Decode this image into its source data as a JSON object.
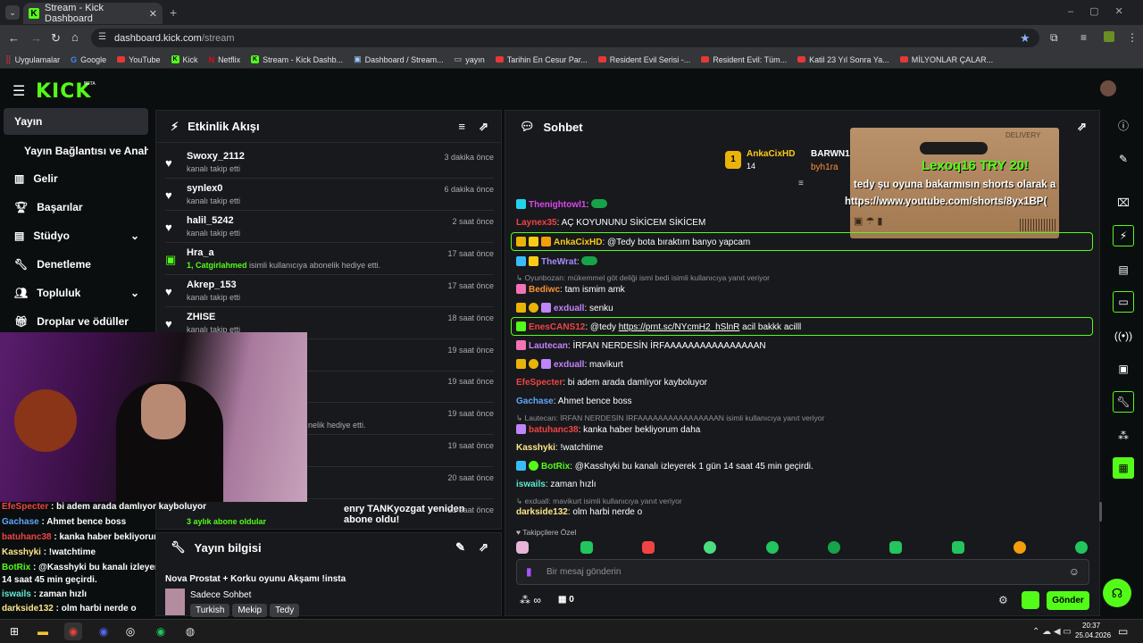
{
  "browser": {
    "tab_title": "Stream - Kick Dashboard",
    "url_host": "dashboard.kick.com",
    "url_path": "/stream",
    "bookmarks": [
      "Uygulamalar",
      "Google",
      "YouTube",
      "Kick",
      "Netflix",
      "Stream - Kick Dashb...",
      "Dashboard / Stream...",
      "yayın",
      "Tarihin En Cesur Par...",
      "Resident Evil Serisi -...",
      "Resident Evil: Tüm...",
      "Katil 23 Yıl Sonra Ya...",
      "MİLYONLAR ÇALAR..."
    ]
  },
  "logo": {
    "text": "KICK",
    "beta": "BETA"
  },
  "sidebar": {
    "items": [
      "Yayın",
      "Yayın Bağlantısı ve Anahtarı",
      "Gelir",
      "Başarılar",
      "Stüdyo",
      "Denetleme",
      "Topluluk",
      "Droplar ve ödüller"
    ]
  },
  "activity": {
    "title": "Etkinlik Akışı",
    "events": [
      {
        "name": "Swoxy_2112",
        "desc": "kanalı takip etti",
        "time": "3 dakika önce"
      },
      {
        "name": "synlex0",
        "desc": "kanalı takip etti",
        "time": "6 dakika önce"
      },
      {
        "name": "halil_5242",
        "desc": "kanalı takip etti",
        "time": "2 saat önce"
      },
      {
        "name": "Hra_a",
        "desc_user": "1, Catgirlahmed",
        "desc": "isimli kullanıcıya abonelik hediye etti.",
        "time": "17 saat önce"
      },
      {
        "name": "Akrep_153",
        "desc": "kanalı takip etti",
        "time": "17 saat önce"
      },
      {
        "name": "ZHISE",
        "desc": "kanalı takip etti",
        "time": "18 saat önce"
      },
      {
        "name": "",
        "desc": "",
        "time": "19 saat önce"
      },
      {
        "name": "",
        "desc": "",
        "time": "19 saat önce"
      },
      {
        "name": "",
        "desc": "nelik hediye etti.",
        "time": "19 saat önce"
      },
      {
        "name": "",
        "desc": "",
        "time": "19 saat önce"
      },
      {
        "name": "",
        "desc": "",
        "time": "20 saat önce"
      },
      {
        "name": "enry TANKyozgat yeniden abone oldu!",
        "desc": "3 aylık abone oldular",
        "time": "21 saat önce"
      }
    ]
  },
  "stream_info": {
    "title": "Yayın bilgisi",
    "stream_title": "Nova Prostat + Korku oyunu Akşamı !insta",
    "category": "Sadece Sohbet",
    "tags": [
      "Turkish",
      "Mekip",
      "Tedy"
    ]
  },
  "chat": {
    "title": "Sohbet",
    "pinned": {
      "user1": "AnkaCixHD",
      "user1_count": "14",
      "user2": "BARWN1",
      "user3": "byh1ra"
    },
    "overlay": {
      "label": "DELIVERY",
      "headline": "Lexoq16 TRY 20!",
      "line1": "tedy şu oyuna bakarmısın shorts olarak a",
      "line2": "https://www.youtube.com/shorts/8yx1BP("
    },
    "messages": [
      {
        "user": "Thenightowl1",
        "text": ":",
        "color": "#d946ef"
      },
      {
        "user": "Laynex35",
        "text": ": AÇ KOYUNUNU SİKİCEM SİKİCEM",
        "color": "#ef4444"
      },
      {
        "user": "AnkaCixHD",
        "text": ": @Tedy bota bıraktım banyo yapcam",
        "color": "#facc15"
      },
      {
        "user": "TheWrat",
        "text": ":",
        "color": "#a78bfa"
      },
      {
        "reply": "Oyunbozan: mükemmel göt deliği ismi bedi isimli kullanıcıya yanıt veriyor"
      },
      {
        "user": "Bediwc",
        "text": ": tam ismim amk",
        "color": "#fb923c"
      },
      {
        "user": "exduall",
        "text": ": senku",
        "color": "#c084fc"
      },
      {
        "user": "EnesCANS12",
        "text": ": @tedy ",
        "link": "https://prnt.sc/NYcmH2_hSlnR",
        "after": " acil bakkk acilll",
        "color": "#ef4444"
      },
      {
        "user": "Lautecan",
        "text": ": İRFAN NERDESİN İRFAAAAAAAAAAAAAAAAN",
        "color": "#c084fc"
      },
      {
        "user": "exduall",
        "text": ": mavikurt",
        "color": "#c084fc"
      },
      {
        "user": "EfeSpecter",
        "text": ": bi adem arada damlıyor kayboluyor",
        "color": "#ef4444"
      },
      {
        "user": "Gachase",
        "text": ": Ahmet bence boss",
        "color": "#60a5fa"
      },
      {
        "reply": "Lautecan: İRFAN NERDESİN İRFAAAAAAAAAAAAAAAAN isimli kullanıcıya yanıt veriyor"
      },
      {
        "user": "batuhanc38",
        "text": ": kanka haber bekliyorum daha",
        "color": "#ef4444"
      },
      {
        "user": "Kasshyki",
        "text": ": !watchtime",
        "color": "#fde68a"
      },
      {
        "user": "BotRix",
        "text": ": @Kasshyki bu kanalı izleyerek 1 gün 14 saat 45 min geçirdi.",
        "color": "#53fc18"
      },
      {
        "user": "iswails",
        "text": ": zaman hızlı",
        "color": "#5eead4"
      },
      {
        "reply": "exduall: mavikurt isimli kullanıcıya yanıt veriyor"
      },
      {
        "user": "darkside132",
        "text": ": olm harbi nerde o",
        "color": "#fde68a"
      }
    ],
    "followers_only": "Takipçilere Özel",
    "input_placeholder": "Bir mesaj gönderin",
    "points": "∞",
    "gifts": "0",
    "send": "Gönder"
  },
  "webcam_overlay": [
    {
      "user": "EfeSpecter",
      "text": " : bi adem arada damlıyor kayboluyor",
      "color": "#ef4444"
    },
    {
      "user": "Gachase",
      "text": " : Ahmet bence boss",
      "color": "#60a5fa"
    },
    {
      "user": "batuhanc38",
      "text": " : kanka haber bekliyorum daha",
      "color": "#ef4444"
    },
    {
      "user": "Kasshyki",
      "text": " : !watchtime",
      "color": "#fde68a"
    },
    {
      "user": "BotRix",
      "text": " : @Kasshyki bu kanalı izleyerek 1 gün",
      "color": "#53fc18"
    },
    {
      "user": "",
      "text": "14 saat 45 min geçirdi.",
      "color": "#fff"
    },
    {
      "user": "iswails",
      "text": " : zaman hızlı",
      "color": "#5eead4"
    },
    {
      "user": "darkside132",
      "text": " : olm harbi nerde o",
      "color": "#fde68a"
    }
  ],
  "taskbar": {
    "time": "20:37",
    "date": "25.04.2026"
  }
}
